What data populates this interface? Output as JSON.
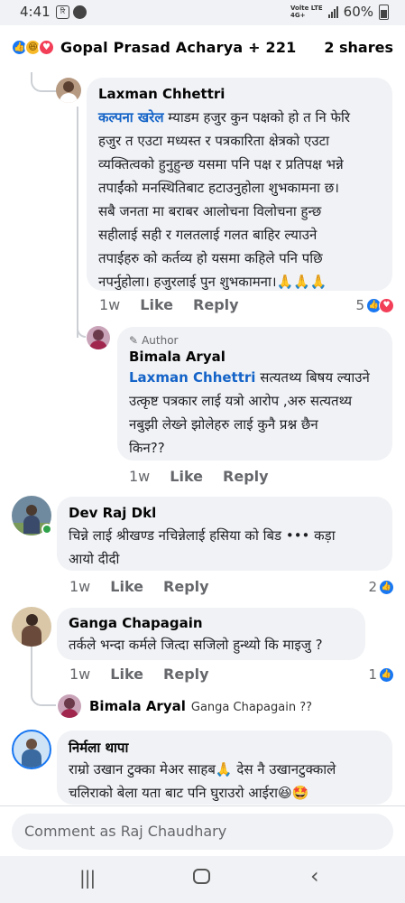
{
  "status_bar": {
    "time": "4:41",
    "net_label": "Volte LTE",
    "net_speed": "4G+",
    "battery": "60%"
  },
  "header": {
    "names": "Gopal Prasad Acharya + 221",
    "shares": "2 shares"
  },
  "comments": [
    {
      "author": "Laxman Chhettri",
      "mention": "कल्पना खरेल",
      "lines": [
        " म्याडम हजुर कुन पक्षको हो त नि फेरि",
        "हजुर त एउटा मध्यस्त र पत्रकारिता क्षेत्रको एउटा",
        "व्यक्तित्वको हुनुहुन्छ यसमा पनि पक्ष र प्रतिपक्ष भन्ने",
        "तपाईंको मनस्थितिबाट हटाउनुहोला शुभकामना छ।",
        "सबै  जनता मा   बराबर आलोचना विलोचना हुन्छ",
        "सहीलाई सही र गलतलाई गलत बाहिर ल्याउने",
        "तपाईहरु को कर्तव्य हो यसमा कहिले पनि पछि",
        "नपर्नुहोला। हजुरलाई पुन शुभकामना।🙏🙏🙏"
      ],
      "time": "1w",
      "like": "Like",
      "reply": "Reply",
      "reactions": "5"
    },
    {
      "author_badge": "Author",
      "author": "Bimala Aryal",
      "mention": "Laxman Chhettri",
      "lines": [
        " सत्यतथ्य बिषय ल्याउने",
        "उत्कृष्ट पत्रकार लाई यत्रो आरोप ,अरु सत्यतथ्य",
        "नबुझी लेख्ने झोलेहरु लाई कुनै प्रश्न छैन",
        "किन??"
      ],
      "time": "1w",
      "like": "Like",
      "reply": "Reply"
    },
    {
      "author": "Dev Raj Dkl",
      "lines": [
        "चिन्ने लाई श्रीखण्ड नचिन्नेलाई हसिया को बिड ••• कड़ा",
        "आयो दीदी"
      ],
      "time": "1w",
      "like": "Like",
      "reply": "Reply",
      "reactions": "2"
    },
    {
      "author": "Ganga Chapagain",
      "lines": [
        "तर्कले भन्दा कर्मले जित्दा सजिलो हुन्थ्यो कि माइजु ?"
      ],
      "time": "1w",
      "like": "Like",
      "reply": "Reply",
      "reactions": "1"
    },
    {
      "author": "Bimala Aryal",
      "preview": "Ganga Chapagain ??"
    },
    {
      "author": "निर्मला थापा",
      "lines": [
        "राम्रो उखान टुक्का मेअर साहब🙏  देस नै उखानटुक्काले",
        "चलिराको बेला  यता बाट पनि घुराउरो आईरा😆🤩"
      ]
    }
  ],
  "composer": {
    "placeholder": "Comment as Raj Chaudhary"
  },
  "colors": {
    "accent": "#1877f2",
    "bubble": "#f0f2f5",
    "mention": "#1463c8"
  }
}
